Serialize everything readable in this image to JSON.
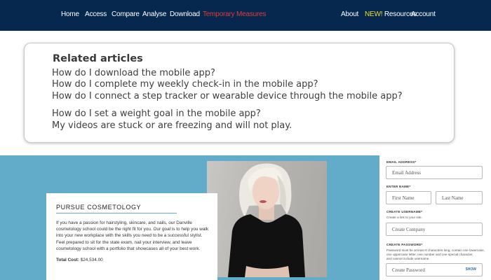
{
  "nav": {
    "left": [
      "Home",
      "Access",
      "Compare",
      "Analyse",
      "Download",
      "Temporary Measures"
    ],
    "about": "About",
    "new_badge": "NEW!",
    "resources": "Resources",
    "account": "Account",
    "active_color": "#e03a3a",
    "badge_color": "#f2dc2a",
    "background": "#06284f"
  },
  "related": {
    "title": "Related articles",
    "items": [
      "How do I download the mobile app?",
      "How do I complete my weekly check-in in the mobile app?",
      "How do I connect a step tracker or wearable device through the mobile app?",
      "How do I set a weight goal in the mobile app?",
      "My videos are stuck or are freezing and will not play."
    ]
  },
  "promo": {
    "background": "#63acc9",
    "heading": "PURSUE COSMETOLOGY",
    "body": "If you have a passion for hairstyling, skincare, and nails, our Danville cosmetology school could be the right fit for you. Our goal is to help you walk into your new workplace with the skills you need to be a successful stylist. Feel prepared to sit for the state exam, nail your interview, and leave cosmetology school with a portfolio that showcases all of your best work.",
    "cost_label": "Total Cost:",
    "cost_value": "$24,534.00"
  },
  "form": {
    "email_label": "EMAIL ADDRESS*",
    "email_placeholder": "Email Address",
    "name_label": "ENTER NAME*",
    "first_placeholder": "First Name",
    "last_placeholder": "Last Name",
    "company_label": "CREATE USERNAME*",
    "company_help": "Create a link to your site.",
    "company_placeholder": "Create Company",
    "password_label": "CREATE PASSWORD*",
    "password_help_1": "Password must be at least 8 characters long, contain one lowercase,",
    "password_help_2": "one uppercase letter, one number and one special character,",
    "password_help_3": "and cannot include username.",
    "password_placeholder": "Create Password",
    "show_label": "SHOW"
  }
}
